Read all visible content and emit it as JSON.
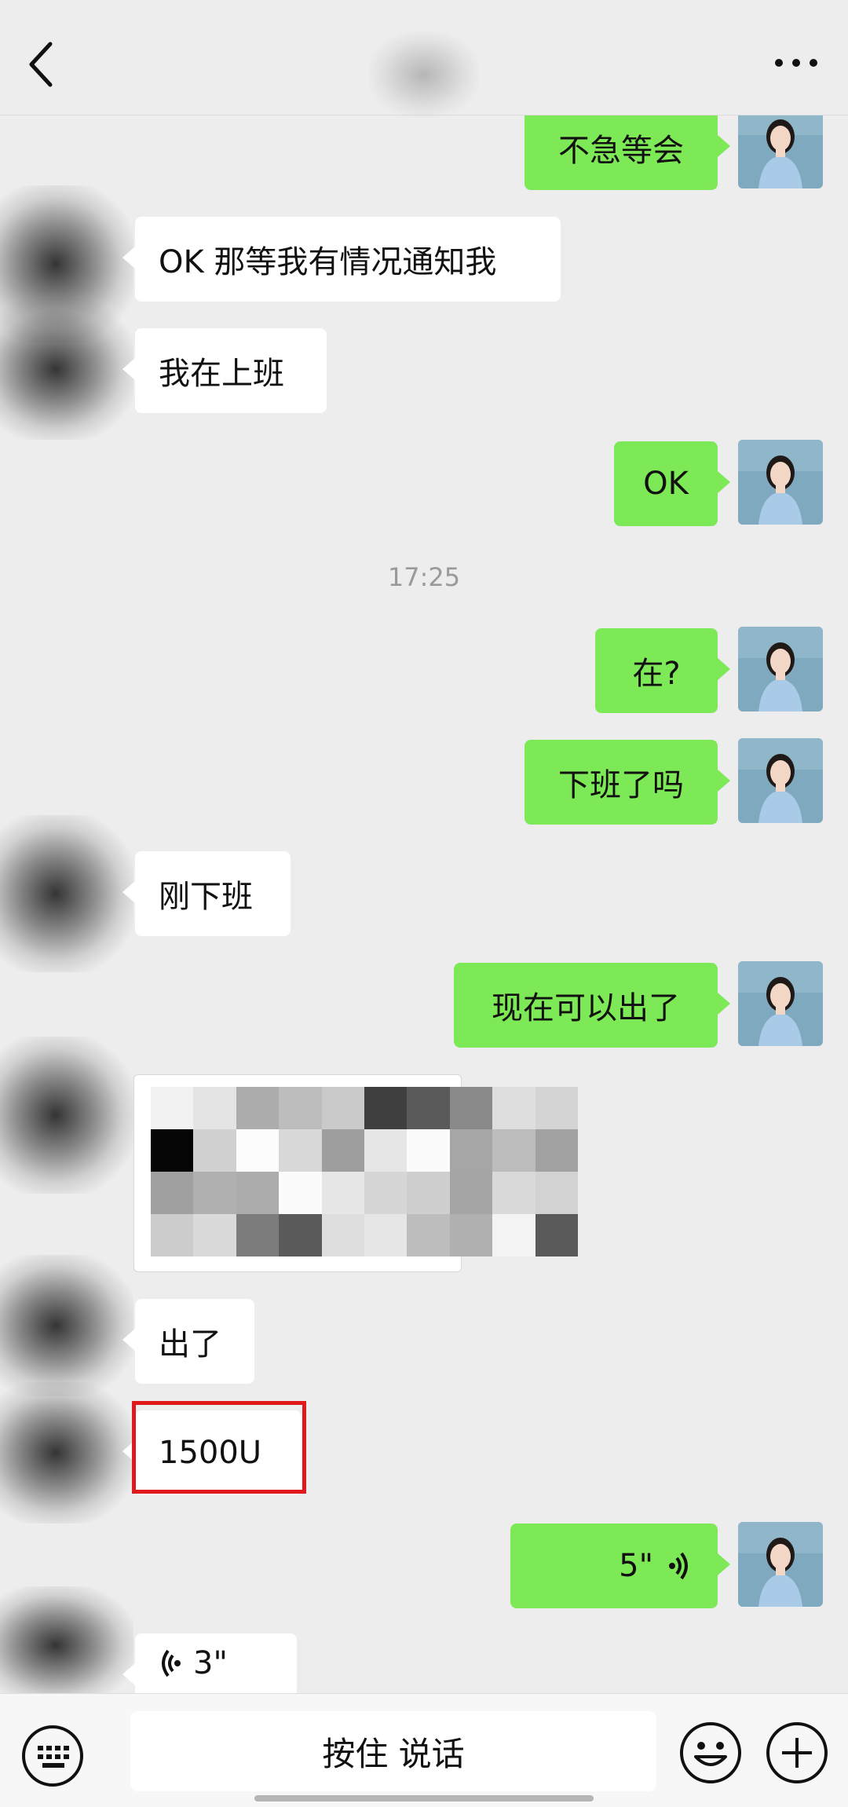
{
  "messages": {
    "m1": "不急等会",
    "m2": "OK 那等我有情况通知我",
    "m3": "我在上班",
    "m4": "OK",
    "time": "17:25",
    "m5": "在?",
    "m6": "下班了吗",
    "m7": "刚下班",
    "m8": "现在可以出了",
    "m9": "出了",
    "m10": "1500U",
    "voice_me": "5\"",
    "voice_other": "3\""
  },
  "input": {
    "hold_to_talk": "按住 说话"
  },
  "colors": {
    "my_bubble": "#7ee957",
    "other_bubble": "#ffffff",
    "highlight": "#e0191c"
  },
  "icons": [
    "back-arrow-icon",
    "more-dots-icon",
    "keyboard-icon",
    "emoji-icon",
    "plus-icon",
    "voice-wave-icon"
  ]
}
